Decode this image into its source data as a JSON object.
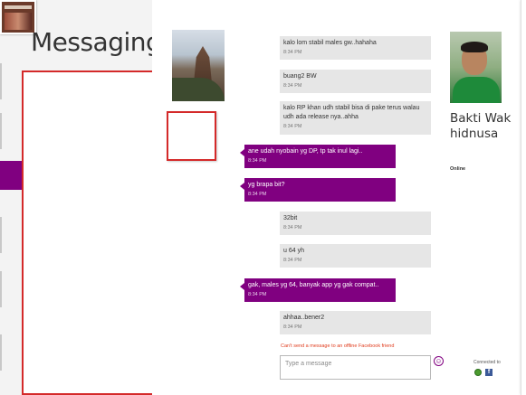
{
  "app": {
    "title": "Messaging"
  },
  "conversation": {
    "messages": [
      {
        "direction": "in",
        "text": "kalo lom stabil males gw..hahaha",
        "time": "8:34 PM"
      },
      {
        "direction": "in",
        "text": "buang2 BW",
        "time": "8:34 PM"
      },
      {
        "direction": "in",
        "text": "kalo RP khan udh stabil bisa di pake terus walau udh ada release nya..ahha",
        "time": "8:34 PM"
      },
      {
        "direction": "out",
        "text": "ane udah nyobain yg DP, tp tak inul lagi..",
        "time": "8:34 PM"
      },
      {
        "direction": "out",
        "text": "yg brapa bit?",
        "time": "8:34 PM"
      },
      {
        "direction": "in",
        "text": "32bit",
        "time": "8:34 PM"
      },
      {
        "direction": "in",
        "text": "u 64 yh",
        "time": "8:34 PM"
      },
      {
        "direction": "out",
        "text": "gak, males yg 64, banyak app yg gak compat..",
        "time": "8:34 PM"
      },
      {
        "direction": "in",
        "text": "ahhaa..bener2",
        "time": "8:34 PM"
      }
    ],
    "error": "Can't send a message to an offline Facebook friend",
    "compose_placeholder": "Type a message"
  },
  "contact": {
    "name": "Bakti Wakhidnusa",
    "status": "Online",
    "connected_label": "Connected to"
  },
  "icons": {
    "emoticon": "smiley-icon",
    "messenger": "windows-live-icon",
    "facebook": "facebook-icon"
  },
  "colors": {
    "accent": "#800080",
    "incoming_bubble": "#e6e6e6",
    "error_text": "#e03b1c",
    "annotation_border": "#d42a2a"
  }
}
